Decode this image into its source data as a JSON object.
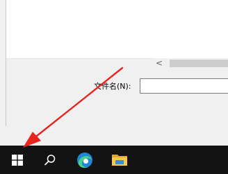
{
  "dialog": {
    "filename_label": "文件名(N):",
    "filename_value": "",
    "scroll_left_glyph": "<"
  },
  "taskbar": {
    "items": [
      {
        "icon": "windows-start-icon"
      },
      {
        "icon": "search-icon"
      },
      {
        "icon": "edge-browser-icon"
      },
      {
        "icon": "file-explorer-icon"
      }
    ]
  },
  "colors": {
    "taskbar_bg": "#131313",
    "annotation_arrow": "#e8251d"
  }
}
